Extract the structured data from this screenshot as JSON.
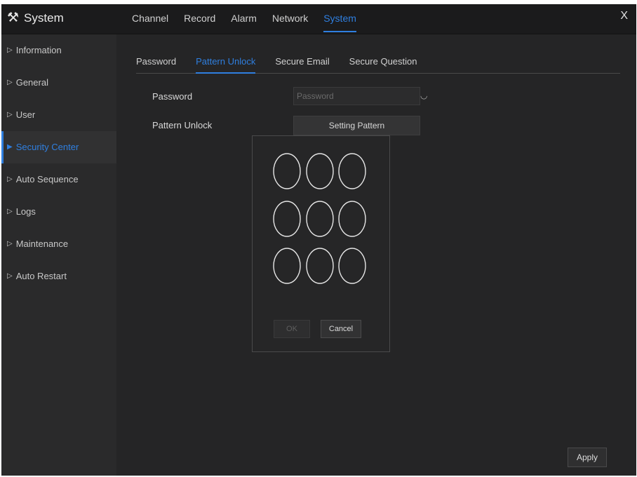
{
  "app": {
    "title": "System",
    "icon": "tools-icon",
    "close_label": "X"
  },
  "main_tabs": [
    {
      "label": "Channel",
      "active": false
    },
    {
      "label": "Record",
      "active": false
    },
    {
      "label": "Alarm",
      "active": false
    },
    {
      "label": "Network",
      "active": false
    },
    {
      "label": "System",
      "active": true
    }
  ],
  "sidebar": {
    "items": [
      {
        "label": "Information",
        "active": false
      },
      {
        "label": "General",
        "active": false
      },
      {
        "label": "User",
        "active": false
      },
      {
        "label": "Security Center",
        "active": true
      },
      {
        "label": "Auto Sequence",
        "active": false
      },
      {
        "label": "Logs",
        "active": false
      },
      {
        "label": "Maintenance",
        "active": false
      },
      {
        "label": "Auto Restart",
        "active": false
      }
    ]
  },
  "sub_tabs": [
    {
      "label": "Password",
      "active": false
    },
    {
      "label": "Pattern Unlock",
      "active": true
    },
    {
      "label": "Secure Email",
      "active": false
    },
    {
      "label": "Secure Question",
      "active": false
    }
  ],
  "form": {
    "password_label": "Password",
    "password_placeholder": "Password",
    "password_value": "",
    "pattern_label": "Pattern Unlock",
    "setting_pattern_button": "Setting Pattern"
  },
  "pattern_popup": {
    "grid": "3x3",
    "ok_label": "OK",
    "ok_enabled": false,
    "cancel_label": "Cancel"
  },
  "apply_label": "Apply",
  "colors": {
    "accent": "#2f7fe0",
    "background": "#252526",
    "sidebar": "#2a2a2b",
    "topbar": "#1b1b1c"
  }
}
